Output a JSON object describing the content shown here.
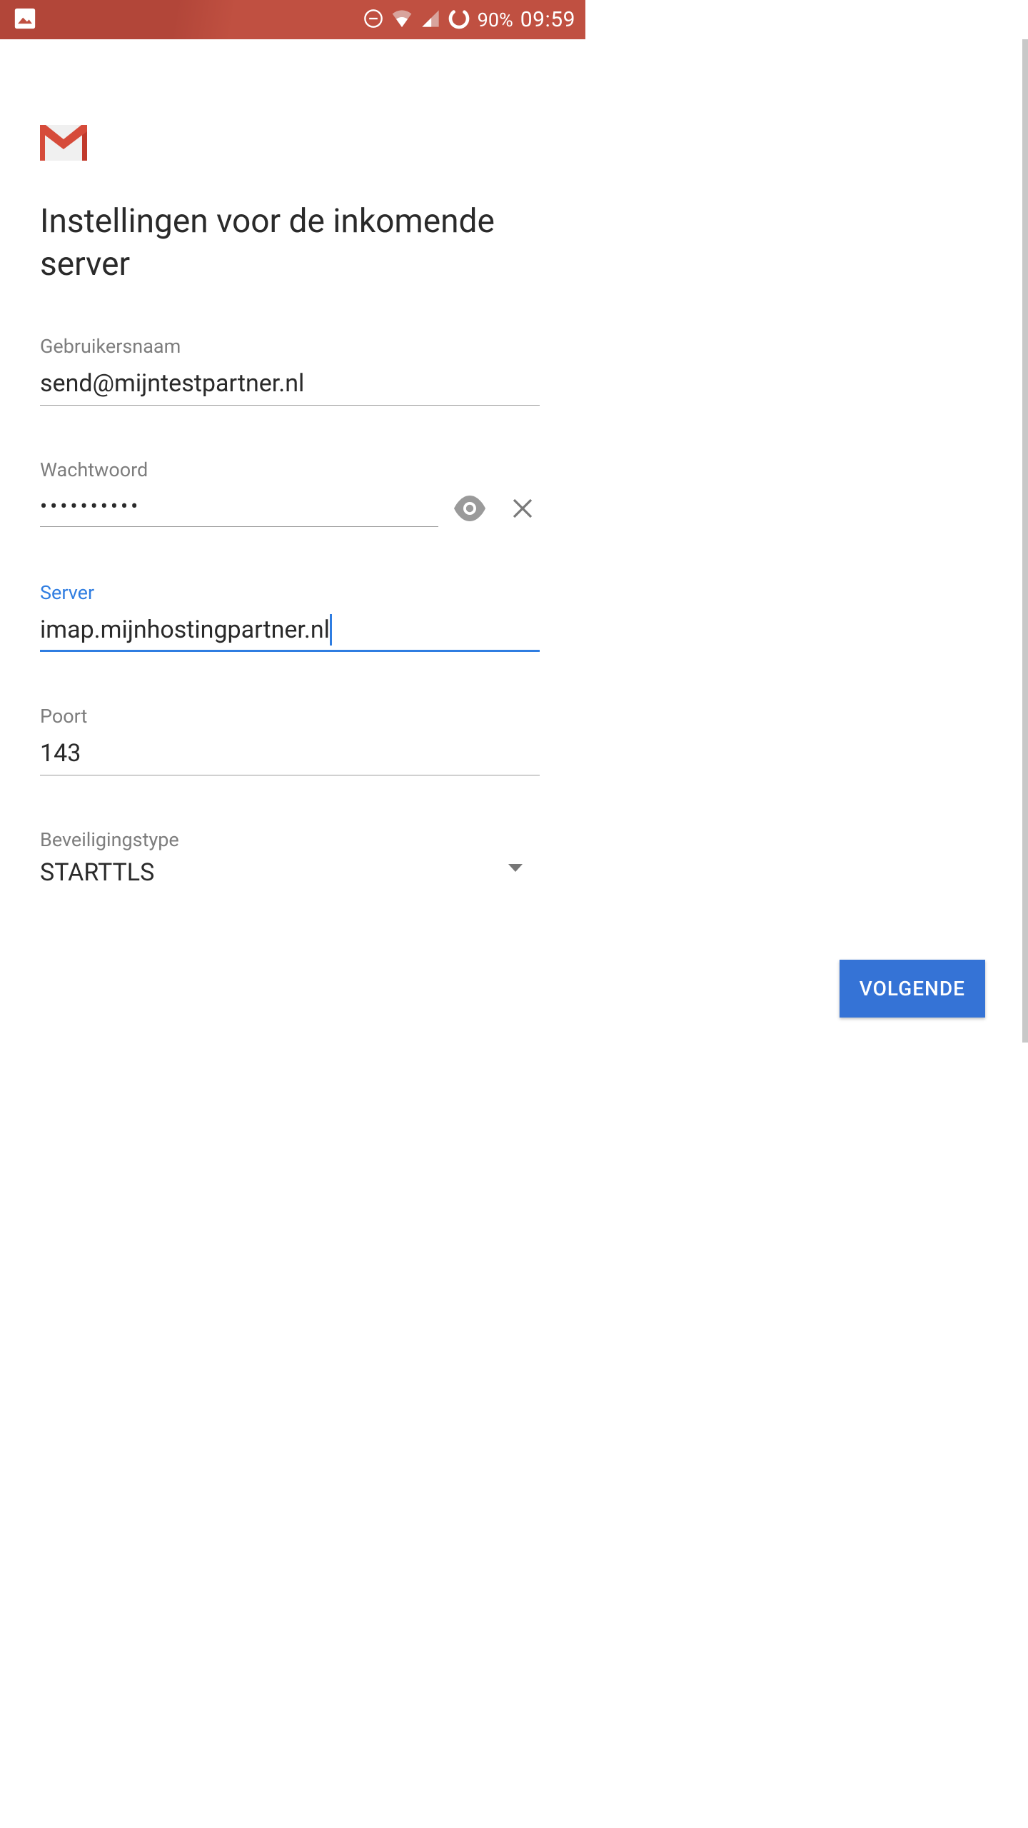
{
  "status": {
    "battery": "90%",
    "time": "09:59"
  },
  "header": {
    "title": "Instellingen voor de inkomende server"
  },
  "fields": {
    "username": {
      "label": "Gebruikersnaam",
      "value": "send@mijntestpartner.nl"
    },
    "password": {
      "label": "Wachtwoord",
      "value": "••••••••••"
    },
    "server": {
      "label": "Server",
      "value": "imap.mijnhostingpartner.nl"
    },
    "port": {
      "label": "Poort",
      "value": "143"
    },
    "security": {
      "label": "Beveiligingstype",
      "value": "STARTTLS"
    }
  },
  "buttons": {
    "next": "VOLGENDE"
  }
}
